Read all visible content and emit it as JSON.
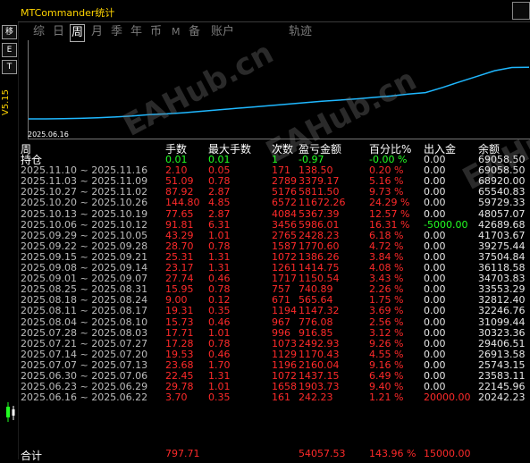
{
  "window": {
    "title": "MTCommander统计"
  },
  "toolbar": {
    "btn1": "移",
    "btn2": "E",
    "btn3": "T",
    "version": "V5.15"
  },
  "tabs": [
    {
      "label": "综"
    },
    {
      "label": "日"
    },
    {
      "label": "周",
      "active": true
    },
    {
      "label": "月"
    },
    {
      "label": "季"
    },
    {
      "label": "年"
    },
    {
      "label": "币"
    },
    {
      "label": "M"
    },
    {
      "label": "备"
    },
    {
      "label": "账户"
    },
    {
      "label": "轨迹"
    }
  ],
  "chart_data": {
    "type": "line",
    "x_tick": "2025.06.16",
    "series": [
      {
        "values": [
          15000,
          15000,
          15200,
          15600,
          16200,
          17000,
          18000,
          19500,
          20242,
          21500,
          23000,
          24500,
          26000,
          27500,
          29000,
          30500,
          32000,
          33500,
          34700,
          36000,
          37500,
          39000,
          41000,
          42600,
          48000,
          54000,
          59700,
          65500,
          68900,
          69058
        ]
      }
    ],
    "ylim": [
      0,
      75000
    ]
  },
  "watermark": "EAHub.cn",
  "table": {
    "headers": {
      "period": "周",
      "lots": "手数",
      "max_lots": "最大手数",
      "count": "次数",
      "pnl": "盈亏金额",
      "pct": "百分比%",
      "inout": "出入金",
      "balance": "余额"
    },
    "holding": {
      "label": "持仓",
      "lots": "0.01",
      "max_lots": "0.01",
      "count": "1",
      "pnl": "-0.97",
      "pct": "-0.00 %",
      "inout": "0.00",
      "balance": "69058.50"
    },
    "rows": [
      {
        "period": "2025.11.10 ~ 2025.11.16",
        "lots": "2.10",
        "max_lots": "0.05",
        "count": "171",
        "pnl": "138.50",
        "pct": "0.20 %",
        "inout": "0.00",
        "balance": "69058.50"
      },
      {
        "period": "2025.11.03 ~ 2025.11.09",
        "lots": "51.09",
        "max_lots": "0.78",
        "count": "2789",
        "pnl": "3379.17",
        "pct": "5.16 %",
        "inout": "0.00",
        "balance": "68920.00"
      },
      {
        "period": "2025.10.27 ~ 2025.11.02",
        "lots": "87.92",
        "max_lots": "2.87",
        "count": "5176",
        "pnl": "5811.50",
        "pct": "9.73 %",
        "inout": "0.00",
        "balance": "65540.83"
      },
      {
        "period": "2025.10.20 ~ 2025.10.26",
        "lots": "144.80",
        "max_lots": "4.85",
        "count": "6572",
        "pnl": "11672.26",
        "pct": "24.29 %",
        "inout": "0.00",
        "balance": "59729.33"
      },
      {
        "period": "2025.10.13 ~ 2025.10.19",
        "lots": "77.65",
        "max_lots": "2.87",
        "count": "4084",
        "pnl": "5367.39",
        "pct": "12.57 %",
        "inout": "0.00",
        "balance": "48057.07"
      },
      {
        "period": "2025.10.06 ~ 2025.10.12",
        "lots": "91.81",
        "max_lots": "6.31",
        "count": "3456",
        "pnl": "5986.01",
        "pct": "16.31 %",
        "inout": "-5000.00",
        "balance": "42689.68",
        "inout_green": true
      },
      {
        "period": "2025.09.29 ~ 2025.10.05",
        "lots": "43.29",
        "max_lots": "1.01",
        "count": "2765",
        "pnl": "2428.23",
        "pct": "6.18 %",
        "inout": "0.00",
        "balance": "41703.67"
      },
      {
        "period": "2025.09.22 ~ 2025.09.28",
        "lots": "28.70",
        "max_lots": "0.78",
        "count": "1587",
        "pnl": "1770.60",
        "pct": "4.72 %",
        "inout": "0.00",
        "balance": "39275.44"
      },
      {
        "period": "2025.09.15 ~ 2025.09.21",
        "lots": "25.31",
        "max_lots": "1.31",
        "count": "1072",
        "pnl": "1386.26",
        "pct": "3.84 %",
        "inout": "0.00",
        "balance": "37504.84"
      },
      {
        "period": "2025.09.08 ~ 2025.09.14",
        "lots": "23.17",
        "max_lots": "1.31",
        "count": "1261",
        "pnl": "1414.75",
        "pct": "4.08 %",
        "inout": "0.00",
        "balance": "36118.58"
      },
      {
        "period": "2025.09.01 ~ 2025.09.07",
        "lots": "27.74",
        "max_lots": "0.46",
        "count": "1717",
        "pnl": "1150.54",
        "pct": "3.43 %",
        "inout": "0.00",
        "balance": "34703.83"
      },
      {
        "period": "2025.08.25 ~ 2025.08.31",
        "lots": "15.95",
        "max_lots": "0.78",
        "count": "757",
        "pnl": "740.89",
        "pct": "2.26 %",
        "inout": "0.00",
        "balance": "33553.29"
      },
      {
        "period": "2025.08.18 ~ 2025.08.24",
        "lots": "9.00",
        "max_lots": "0.12",
        "count": "671",
        "pnl": "565.64",
        "pct": "1.75 %",
        "inout": "0.00",
        "balance": "32812.40"
      },
      {
        "period": "2025.08.11 ~ 2025.08.17",
        "lots": "19.31",
        "max_lots": "0.35",
        "count": "1194",
        "pnl": "1147.32",
        "pct": "3.69 %",
        "inout": "0.00",
        "balance": "32246.76"
      },
      {
        "period": "2025.08.04 ~ 2025.08.10",
        "lots": "15.73",
        "max_lots": "0.46",
        "count": "967",
        "pnl": "776.08",
        "pct": "2.56 %",
        "inout": "0.00",
        "balance": "31099.44"
      },
      {
        "period": "2025.07.28 ~ 2025.08.03",
        "lots": "17.71",
        "max_lots": "1.01",
        "count": "996",
        "pnl": "916.85",
        "pct": "3.12 %",
        "inout": "0.00",
        "balance": "30323.36"
      },
      {
        "period": "2025.07.21 ~ 2025.07.27",
        "lots": "17.28",
        "max_lots": "0.78",
        "count": "1073",
        "pnl": "2492.93",
        "pct": "9.26 %",
        "inout": "0.00",
        "balance": "29406.51"
      },
      {
        "period": "2025.07.14 ~ 2025.07.20",
        "lots": "19.53",
        "max_lots": "0.46",
        "count": "1129",
        "pnl": "1170.43",
        "pct": "4.55 %",
        "inout": "0.00",
        "balance": "26913.58"
      },
      {
        "period": "2025.07.07 ~ 2025.07.13",
        "lots": "23.68",
        "max_lots": "1.70",
        "count": "1196",
        "pnl": "2160.04",
        "pct": "9.16 %",
        "inout": "0.00",
        "balance": "25743.15"
      },
      {
        "period": "2025.06.30 ~ 2025.07.06",
        "lots": "22.45",
        "max_lots": "1.31",
        "count": "1072",
        "pnl": "1437.15",
        "pct": "6.49 %",
        "inout": "0.00",
        "balance": "23583.11"
      },
      {
        "period": "2025.06.23 ~ 2025.06.29",
        "lots": "29.78",
        "max_lots": "1.01",
        "count": "1658",
        "pnl": "1903.73",
        "pct": "9.40 %",
        "inout": "0.00",
        "balance": "22145.96"
      },
      {
        "period": "2025.06.16 ~ 2025.06.22",
        "lots": "3.70",
        "max_lots": "0.35",
        "count": "161",
        "pnl": "242.23",
        "pct": "1.21 %",
        "inout": "20000.00",
        "balance": "20242.23",
        "inout_red": true
      }
    ],
    "total": {
      "label": "合计",
      "lots": "797.71",
      "pnl": "54057.53",
      "pct": "143.96 %",
      "inout": "15000.00"
    }
  },
  "colors": {
    "accent": "#ffd400",
    "line": "#1fb8ff",
    "positive": "#ff2a2a",
    "negative": "#22ff22"
  }
}
